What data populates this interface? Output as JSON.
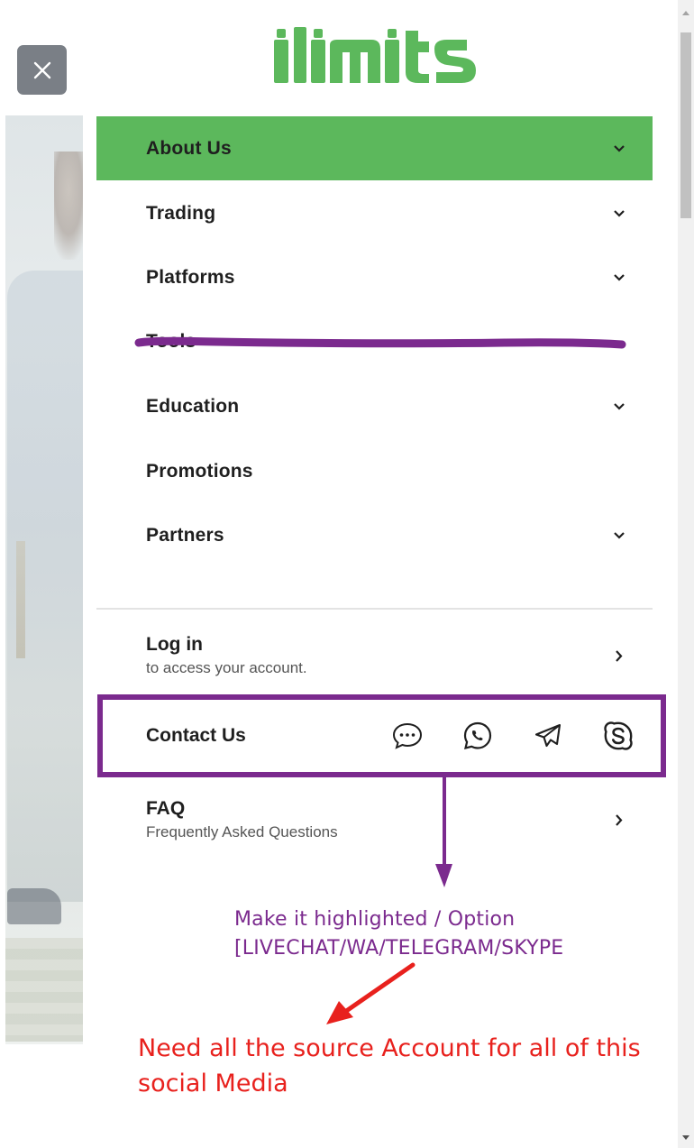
{
  "brand": {
    "logo_text": "ılımıts",
    "accent_color": "#5cb85c"
  },
  "close": {
    "icon": "close-icon"
  },
  "menu": {
    "items": [
      {
        "label": "About Us",
        "has_submenu": true,
        "active": true
      },
      {
        "label": "Trading",
        "has_submenu": true
      },
      {
        "label": "Platforms",
        "has_submenu": true
      },
      {
        "label": "Tools",
        "has_submenu": false,
        "struck_out": true
      },
      {
        "label": "Education",
        "has_submenu": true
      },
      {
        "label": "Promotions",
        "has_submenu": false
      },
      {
        "label": "Partners",
        "has_submenu": true
      }
    ]
  },
  "login": {
    "title": "Log in",
    "subtitle": "to access your account."
  },
  "contact": {
    "title": "Contact Us",
    "icons": [
      "livechat-icon",
      "whatsapp-icon",
      "telegram-icon",
      "skype-icon"
    ]
  },
  "faq": {
    "title": "FAQ",
    "subtitle": "Frequently Asked Questions"
  },
  "annotations": {
    "purple_note_line1": "Make it highlighted / Option",
    "purple_note_line2": "[LIVECHAT/WA/TELEGRAM/SKYPE",
    "red_note_line1": "Need all the source Account for all of this",
    "red_note_line2": "social Media",
    "purple_color": "#7b2a8e",
    "red_color": "#e8211d"
  }
}
